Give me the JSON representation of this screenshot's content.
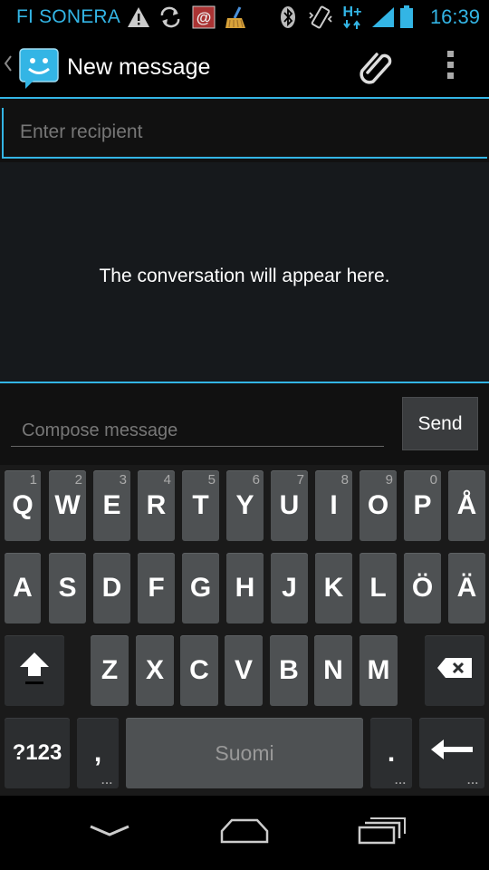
{
  "status_bar": {
    "carrier": "FI SONERA",
    "network_type": "H+",
    "time": "16:39",
    "icons": [
      "warning-icon",
      "sync-icon",
      "email-icon",
      "cleaner-app-icon",
      "bluetooth-icon",
      "vibrate-icon",
      "network-type-icon",
      "signal-icon",
      "battery-icon"
    ]
  },
  "action_bar": {
    "title": "New message",
    "app_icon": "messaging-app-icon",
    "attach_icon": "paperclip-icon",
    "overflow_icon": "overflow-menu-icon"
  },
  "recipient": {
    "placeholder": "Enter recipient",
    "value": ""
  },
  "conversation": {
    "empty_text": "The conversation will appear here."
  },
  "compose": {
    "placeholder": "Compose message",
    "value": "",
    "send_label": "Send"
  },
  "keyboard": {
    "row1": [
      {
        "label": "Q",
        "hint": "1"
      },
      {
        "label": "W",
        "hint": "2"
      },
      {
        "label": "E",
        "hint": "3"
      },
      {
        "label": "R",
        "hint": "4"
      },
      {
        "label": "T",
        "hint": "5"
      },
      {
        "label": "Y",
        "hint": "6"
      },
      {
        "label": "U",
        "hint": "7"
      },
      {
        "label": "I",
        "hint": "8"
      },
      {
        "label": "O",
        "hint": "9"
      },
      {
        "label": "P",
        "hint": "0"
      },
      {
        "label": "Å",
        "hint": ""
      }
    ],
    "row2": [
      "A",
      "S",
      "D",
      "F",
      "G",
      "H",
      "J",
      "K",
      "L",
      "Ö",
      "Ä"
    ],
    "row3": [
      "Z",
      "X",
      "C",
      "V",
      "B",
      "N",
      "M"
    ],
    "symbols_label": "?123",
    "comma_label": ",",
    "space_label": "Suomi",
    "period_label": ".",
    "more_dots": "..."
  },
  "colors": {
    "accent": "#33b5e5",
    "key": "#4e5153",
    "key_dark": "#2c2e30",
    "conversation_bg": "#16191c"
  }
}
